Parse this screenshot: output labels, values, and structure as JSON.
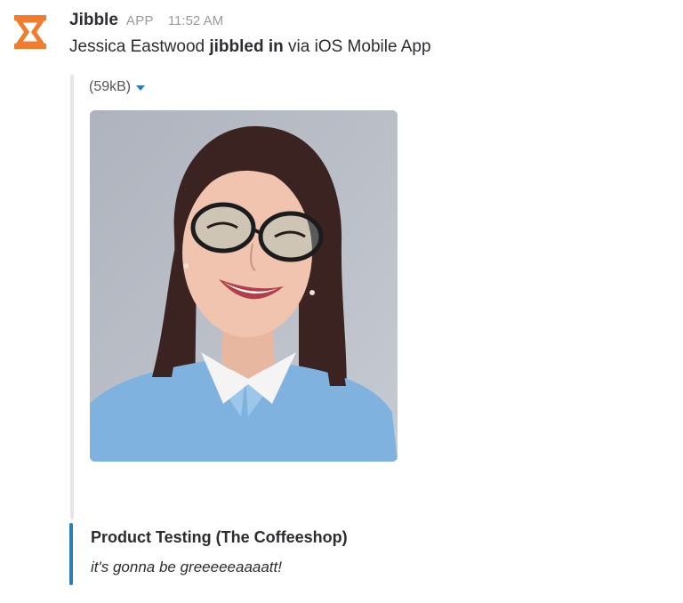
{
  "message": {
    "app_name": "Jibble",
    "app_badge": "APP",
    "timestamp": "11:52 AM",
    "text_user": "Jessica Eastwood",
    "text_action": "jibbled in",
    "text_suffix": "via iOS Mobile App",
    "app_icon": "jibble-hourglass-icon",
    "accent_color": "#f27c2e"
  },
  "file": {
    "size_label": "(59kB)",
    "dropdown_icon": "caret-down-icon",
    "image_alt": "Selfie photo"
  },
  "attachment": {
    "title": "Product Testing (The Coffeeshop)",
    "note": "it's gonna be greeeeeaaaatt!",
    "bar_color": "#2a7fb8"
  }
}
